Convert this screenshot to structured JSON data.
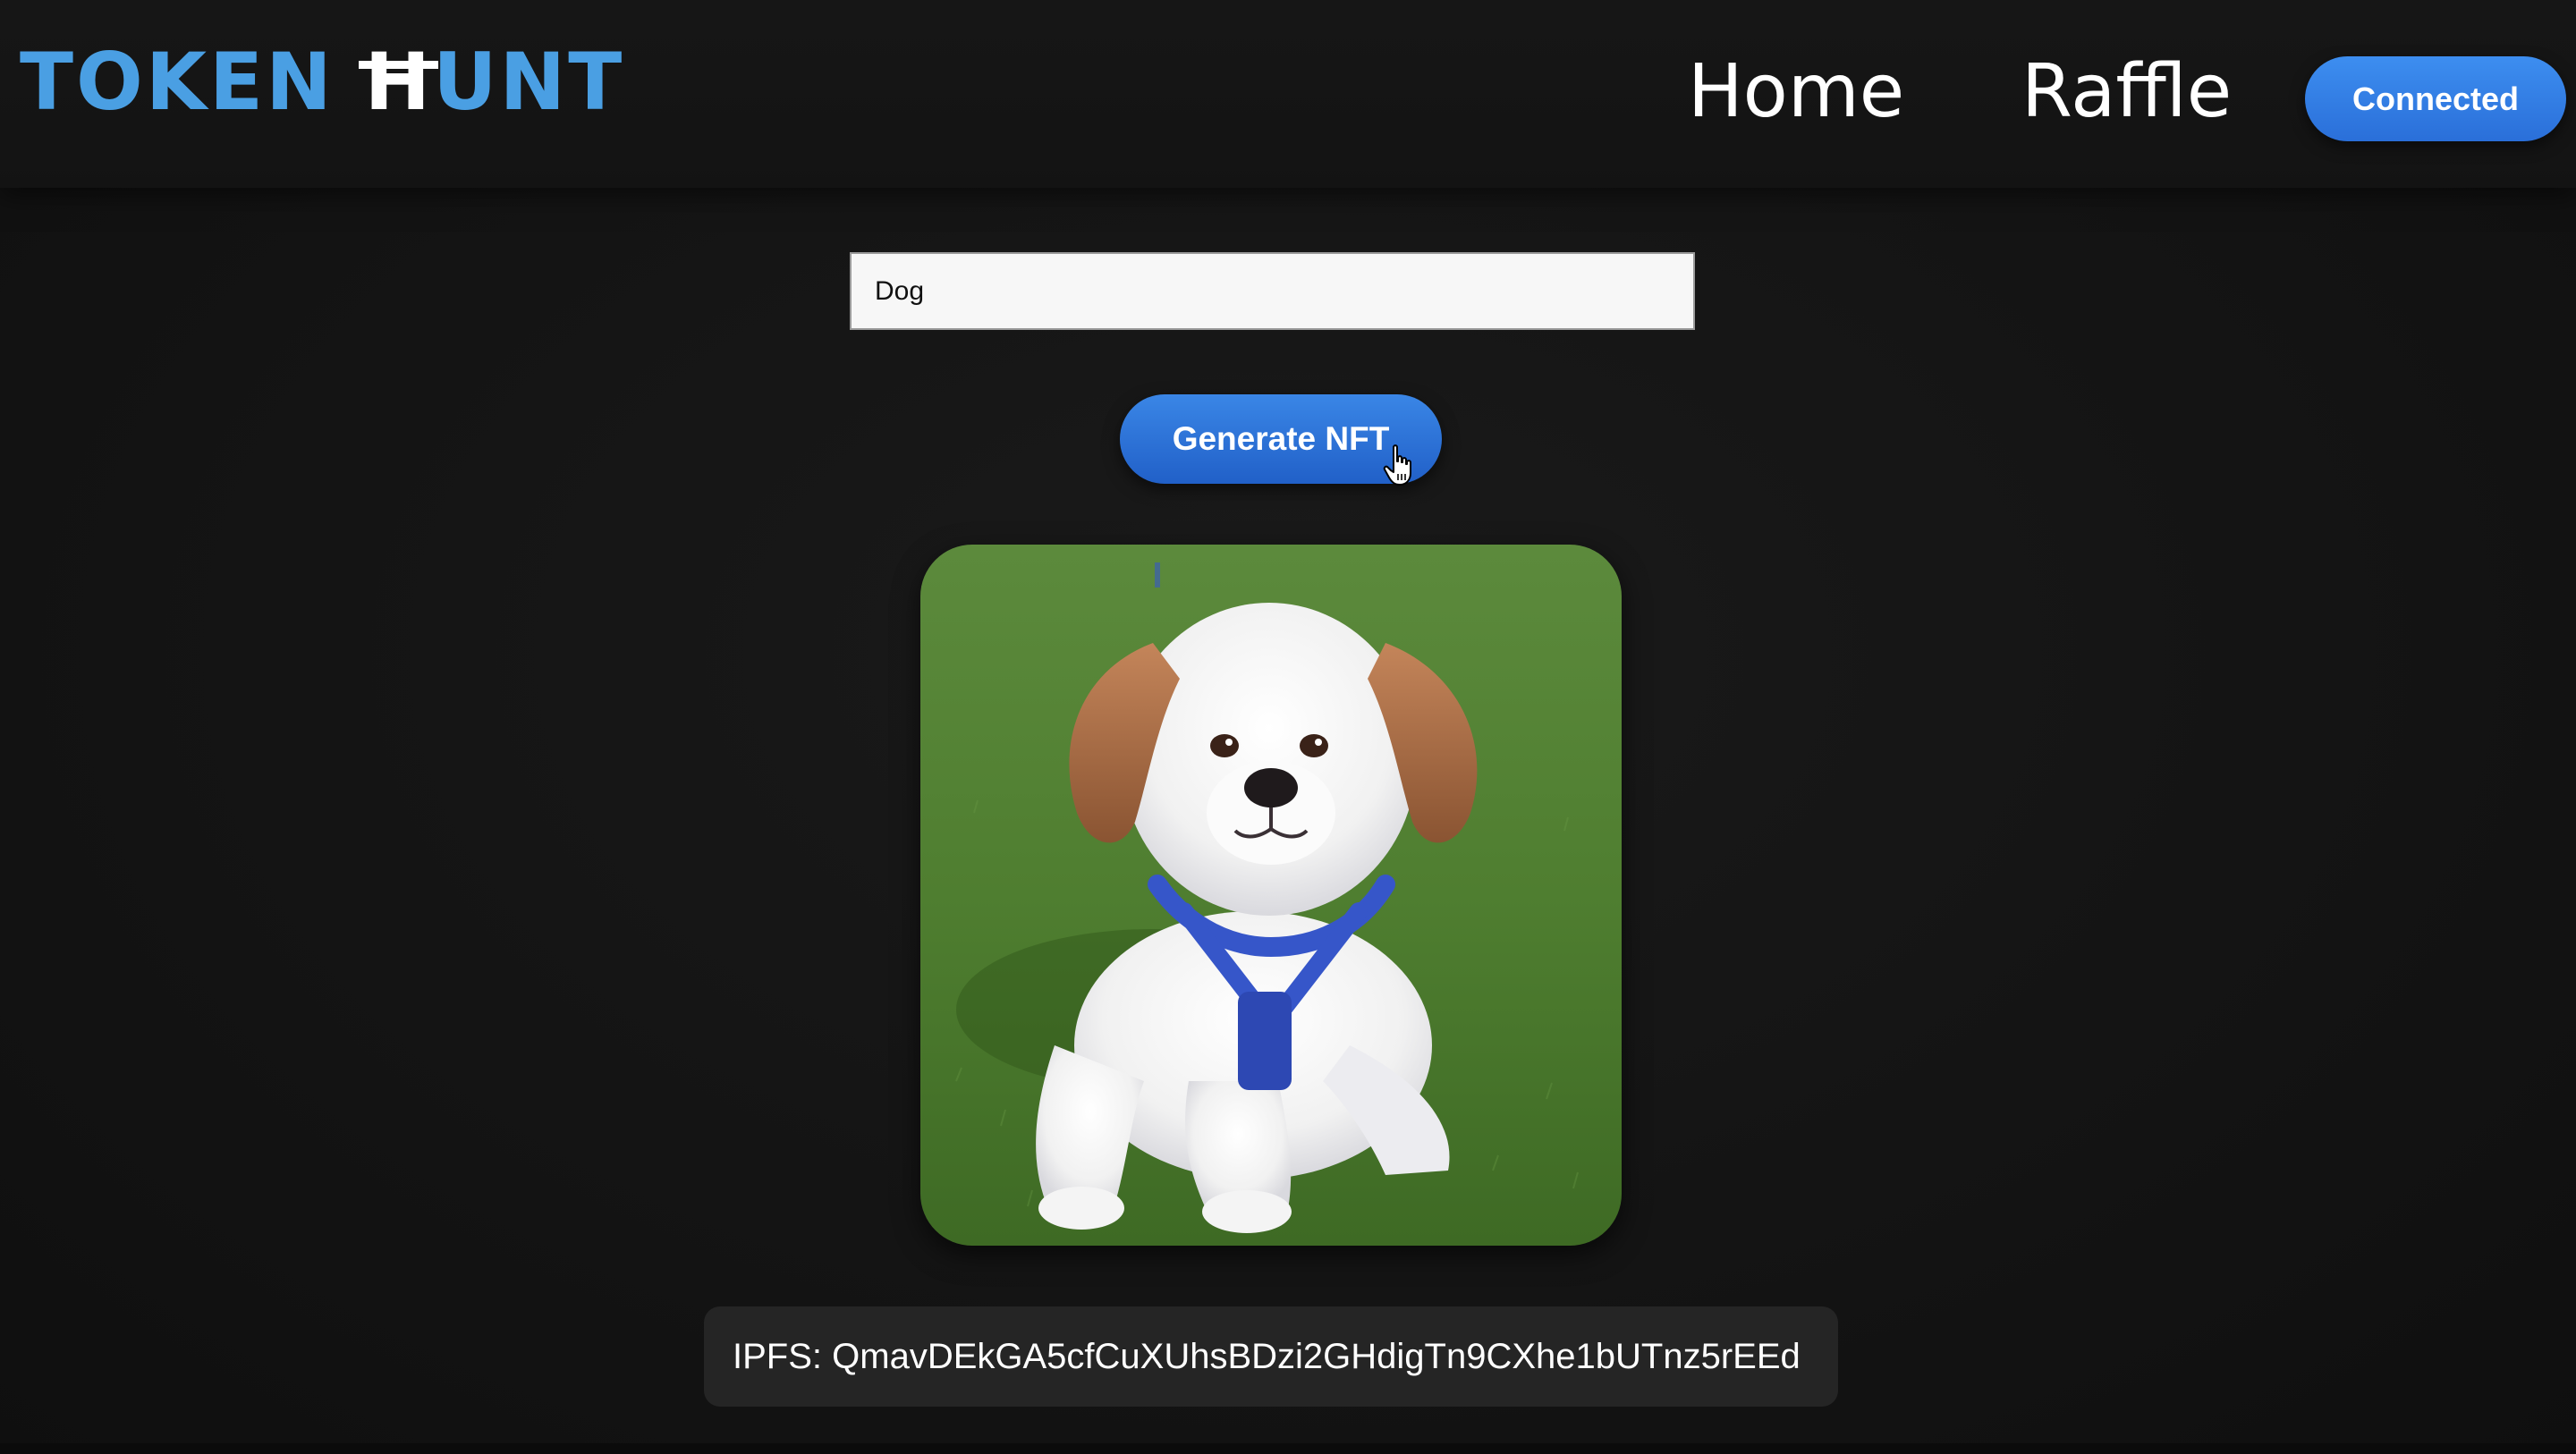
{
  "header": {
    "logo_left": "TOKEN ",
    "logo_h": "H",
    "logo_right": "UNT",
    "nav": [
      {
        "label": "Home"
      },
      {
        "label": "Raffle"
      }
    ],
    "connect_label": "Connected",
    "colors": {
      "brand": "#4a9fe3",
      "button": "#2a6fd9"
    }
  },
  "form": {
    "prompt_value": "Dog",
    "generate_label": "Generate NFT"
  },
  "result": {
    "image_alt": "Generated NFT image of a white puppy with brown ears wearing a blue harness lying on grass",
    "ipfs_text": "IPFS: QmavDEkGA5cfCuXUhsBDzi2GHdigTn9CXhe1bUTnz5rEEd"
  },
  "icons": {
    "cursor": "hand-pointer-icon"
  }
}
